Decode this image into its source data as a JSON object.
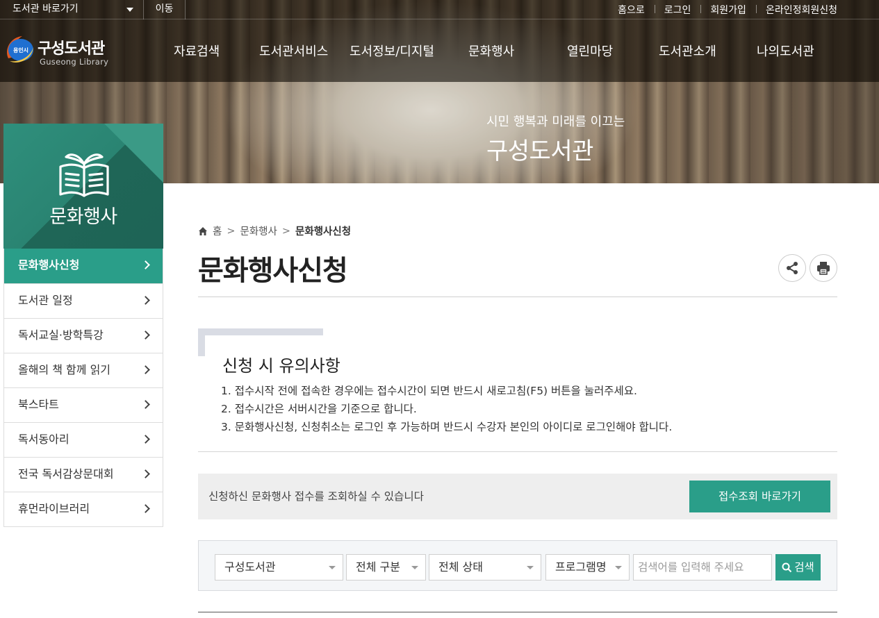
{
  "topbar": {
    "shortcut_label": "도서관 바로가기",
    "move_label": "이동",
    "links": [
      "홈으로",
      "로그인",
      "회원가입",
      "온라인정회원신청"
    ]
  },
  "logo": {
    "badge": "용인시",
    "kor": "구성도서관",
    "eng": "Guseong Library"
  },
  "gnb": [
    "자료검색",
    "도서관서비스",
    "도서정보/디지털",
    "문화행사",
    "열린마당",
    "도서관소개",
    "나의도서관"
  ],
  "hero": {
    "subtitle": "시민 행복과 미래를 이끄는",
    "title": "구성도서관"
  },
  "sidebar": {
    "title": "문화행사",
    "items": [
      {
        "label": "문화행사신청",
        "active": true
      },
      {
        "label": "도서관 일정"
      },
      {
        "label": "독서교실·방학특강"
      },
      {
        "label": "올해의 책 함께 읽기"
      },
      {
        "label": "북스타트"
      },
      {
        "label": "독서동아리"
      },
      {
        "label": "전국 독서감상문대회"
      },
      {
        "label": "휴먼라이브러리"
      }
    ]
  },
  "breadcrumb": {
    "home": "홈",
    "level1": "문화행사",
    "current": "문화행사신청",
    "separator": ">"
  },
  "page": {
    "title": "문화행사신청"
  },
  "notice": {
    "title": "신청 시 유의사항",
    "items": [
      "1.  접수시작 전에 접속한 경우에는 접수시간이 되면 반드시 새로고침(F5) 버튼을 눌러주세요.",
      "2.  접수시간은 서버시간을 기준으로 합니다.",
      "3.  문화행사신청, 신청취소는 로그인 후 가능하며 반드시 수강자 본인의 아이디로 로그인해야 합니다."
    ]
  },
  "inquiry": {
    "text": "신청하신 문화행사 접수를 조회하실 수 있습니다",
    "button": "접수조회 바로가기"
  },
  "search": {
    "library": "구성도서관",
    "category": "전체 구분",
    "status": "전체 상태",
    "field": "프로그램명",
    "placeholder": "검색어를 입력해 주세요",
    "button": "검색"
  },
  "colors": {
    "accent": "#2a9e89",
    "sidebar_head": "#226f60"
  },
  "icons": [
    "home-icon",
    "share-icon",
    "print-icon",
    "search-icon",
    "book-sprout-icon",
    "chevron-right-icon"
  ]
}
